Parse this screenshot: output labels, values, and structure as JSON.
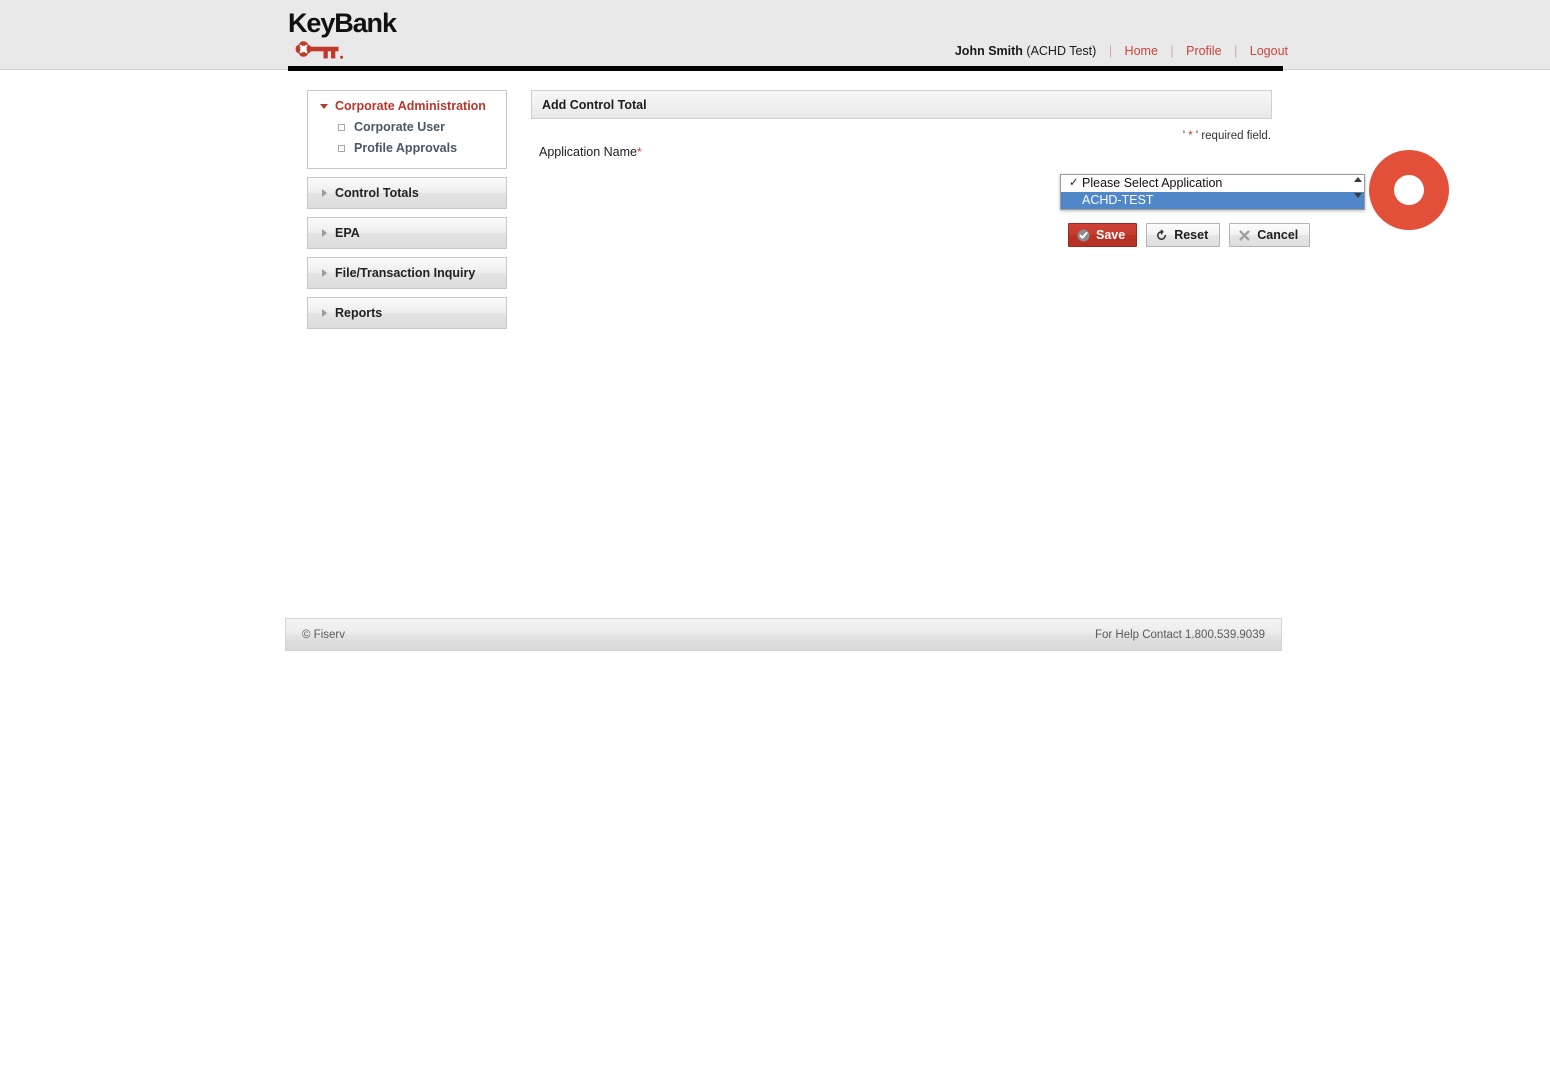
{
  "brand": {
    "name": "KeyBank",
    "logo_icon": "keybank-key-logo",
    "accent_red": "#c8443c",
    "key_red": "#c0392b"
  },
  "header": {
    "user_name": "John Smith",
    "user_org": "(ACHD Test)",
    "nav": [
      {
        "label": "Home",
        "name": "home"
      },
      {
        "label": "Profile",
        "name": "profile"
      },
      {
        "label": "Logout",
        "name": "logout"
      }
    ]
  },
  "sidebar": {
    "groups": [
      {
        "label": "Corporate Administration",
        "name": "corporate-administration",
        "expanded": true,
        "active": true,
        "items": [
          {
            "label": "Corporate User",
            "name": "corporate-user"
          },
          {
            "label": "Profile Approvals",
            "name": "profile-approvals"
          }
        ]
      },
      {
        "label": "Control Totals",
        "name": "control-totals",
        "expanded": false,
        "active": false,
        "items": []
      },
      {
        "label": "EPA",
        "name": "epa",
        "expanded": false,
        "active": false,
        "items": []
      },
      {
        "label": "File/Transaction Inquiry",
        "name": "file-transaction-inquiry",
        "expanded": false,
        "active": false,
        "items": []
      },
      {
        "label": "Reports",
        "name": "reports",
        "expanded": false,
        "active": false,
        "items": []
      }
    ]
  },
  "main": {
    "panel_title": "Add Control Total",
    "required_note_prefix": "' ",
    "required_note_star": "*",
    "required_note_suffix": " ' required field.",
    "field": {
      "label": "Application Name",
      "required_star": "*",
      "name": "application-name"
    },
    "select": {
      "open": true,
      "selected_value": "ACHD-TEST",
      "options": [
        {
          "label": "Please Select Application",
          "checked": true,
          "highlighted": false
        },
        {
          "label": "ACHD-TEST",
          "checked": false,
          "highlighted": true
        }
      ],
      "highlight_color": "#4f87c8"
    },
    "buttons": [
      {
        "label": "Save",
        "name": "save",
        "icon": "check-circle-icon",
        "style": "primary"
      },
      {
        "label": "Reset",
        "name": "reset",
        "icon": "refresh-icon",
        "style": "default"
      },
      {
        "label": "Cancel",
        "name": "cancel",
        "icon": "close-x-icon",
        "style": "default"
      }
    ]
  },
  "overlay": {
    "click_indicator_color": "#e2503a"
  },
  "footer": {
    "copyright": "© Fiserv",
    "help_text": "For Help Contact 1.800.539.9039"
  }
}
